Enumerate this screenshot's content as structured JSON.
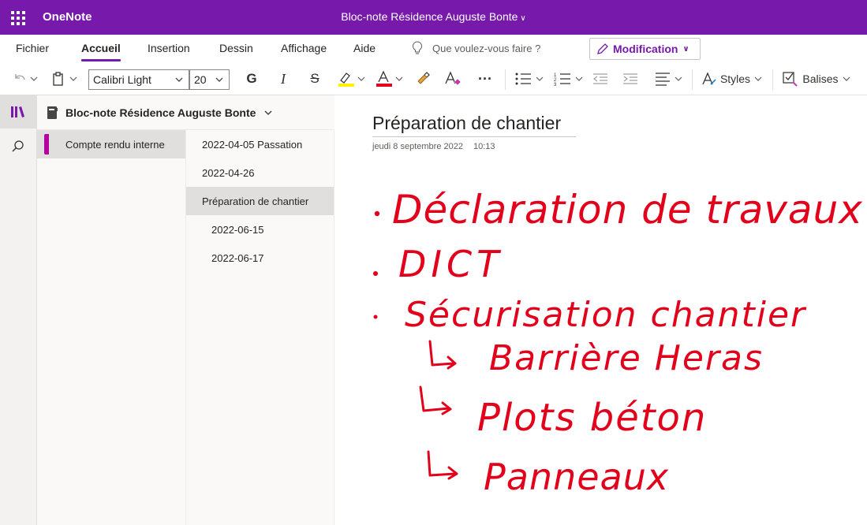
{
  "app": {
    "name": "OneNote",
    "notebook_title": "Bloc-note Résidence Auguste Bonte"
  },
  "menu": {
    "tabs": [
      "Fichier",
      "Accueil",
      "Insertion",
      "Dessin",
      "Affichage",
      "Aide"
    ],
    "active_tab": "Accueil",
    "tell_me": "Que voulez-vous faire ?",
    "mode_button": "Modification"
  },
  "toolbar": {
    "font_name": "Calibri Light",
    "font_size": "20",
    "bold": "G",
    "italic": "I",
    "strike": "S",
    "more": "···",
    "styles_label": "Styles",
    "tags_label": "Balises",
    "colors": {
      "highlight": "#fff100",
      "font_color": "#e3001b",
      "accent": "#7719aa"
    }
  },
  "notebook": {
    "name": "Bloc-note Résidence Auguste Bonte",
    "sections": [
      {
        "label": "Compte rendu interne",
        "color": "#b4009e"
      }
    ],
    "pages": [
      {
        "label": "2022-04-05 Passation",
        "level": 0,
        "active": false
      },
      {
        "label": "2022-04-26",
        "level": 0,
        "active": false
      },
      {
        "label": "Préparation de chantier",
        "level": 0,
        "active": true
      },
      {
        "label": "2022-06-15",
        "level": 1,
        "active": false
      },
      {
        "label": "2022-06-17",
        "level": 1,
        "active": false
      }
    ]
  },
  "page": {
    "title": "Préparation de chantier",
    "date": "jeudi 8 septembre 2022",
    "time": "10:13",
    "ink_lines": [
      "Déclaration de travaux",
      "DICT",
      "Sécurisation chantier",
      "Barrière Heras",
      "Plots béton",
      "Panneaux"
    ],
    "ink_color": "#e3001b"
  }
}
